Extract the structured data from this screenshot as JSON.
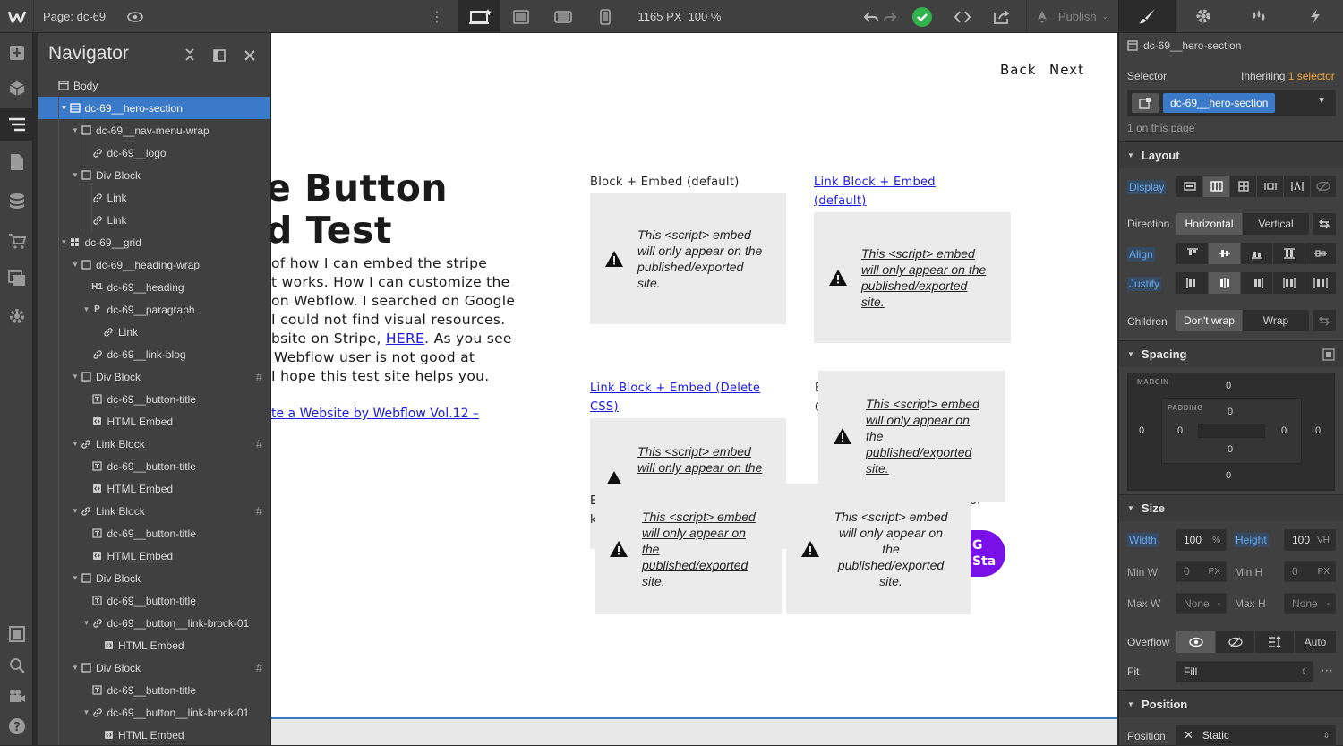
{
  "topbar": {
    "page_label": "Page: dc-69",
    "width_px": "1165 PX",
    "zoom": "100 %",
    "publish_label": "Publish"
  },
  "navigator": {
    "title": "Navigator",
    "rows": [
      {
        "label": "Body",
        "icon": "body-icon"
      },
      {
        "label": "dc-69__hero-section",
        "icon": "section-icon"
      },
      {
        "label": "dc-69__nav-menu-wrap",
        "icon": "div-icon"
      },
      {
        "label": "dc-69__logo",
        "icon": "link-icon"
      },
      {
        "label": "Div Block",
        "icon": "div-icon"
      },
      {
        "label": "Link",
        "icon": "link-icon"
      },
      {
        "label": "Link",
        "icon": "link-icon"
      },
      {
        "label": "dc-69__grid",
        "icon": "grid-icon"
      },
      {
        "label": "dc-69__heading-wrap",
        "icon": "div-icon"
      },
      {
        "label": "dc-69__heading",
        "icon": "heading-icon"
      },
      {
        "label": "dc-69__paragraph",
        "icon": "paragraph-icon"
      },
      {
        "label": "Link",
        "icon": "link-icon"
      },
      {
        "label": "dc-69__link-blog",
        "icon": "link-icon"
      },
      {
        "label": "Div Block",
        "icon": "div-icon"
      },
      {
        "label": "dc-69__button-title",
        "icon": "text-icon"
      },
      {
        "label": "HTML Embed",
        "icon": "embed-icon"
      },
      {
        "label": "Link Block",
        "icon": "link-icon"
      },
      {
        "label": "dc-69__button-title",
        "icon": "text-icon"
      },
      {
        "label": "HTML Embed",
        "icon": "embed-icon"
      },
      {
        "label": "Link Block",
        "icon": "link-icon"
      },
      {
        "label": "dc-69__button-title",
        "icon": "text-icon"
      },
      {
        "label": "HTML Embed",
        "icon": "embed-icon"
      },
      {
        "label": "Div Block",
        "icon": "div-icon"
      },
      {
        "label": "dc-69__button-title",
        "icon": "text-icon"
      },
      {
        "label": "dc-69__button__link-brock-01",
        "icon": "link-icon"
      },
      {
        "label": "HTML Embed",
        "icon": "embed-icon"
      },
      {
        "label": "Div Block",
        "icon": "div-icon"
      },
      {
        "label": "dc-69__button-title",
        "icon": "text-icon"
      },
      {
        "label": "dc-69__button__link-brock-01",
        "icon": "link-icon"
      },
      {
        "label": "HTML Embed",
        "icon": "embed-icon"
      }
    ],
    "hash_symbol": "#"
  },
  "canvas": {
    "nav_back": "Back",
    "nav_next": "Next",
    "hero_title_line1": "e Button",
    "hero_title_line2": "d Test",
    "para_lines": [
      "of how I can embed the stripe",
      "t works. How I can customize the",
      "on Webflow. I searched on Google",
      "I could not find visual resources.",
      "bsite on Stripe, "
    ],
    "para_link": "HERE",
    "para_after_link": ". As you see",
    "para_lines2": [
      "Webflow user is not good at",
      "I hope this test site helps you."
    ],
    "blog_link": "te a Website by Webflow Vol.12 –",
    "block1_label": "Block + Embed (default)",
    "block2_label_l1": "Link Block + Embed",
    "block2_label_l2": "(default)",
    "block3_label_l1": "Link Block + Embed (Delete",
    "block3_label_l2": "CSS)",
    "block4_label_fragment": "E",
    "block4_label_fragment2": "C",
    "block5_fragment": "E",
    "block5_fragment2": "k",
    "block6_fragment": "or",
    "embed_msg": "This <script> embed will only appear on the published/exported site.",
    "embed_msg_cut": "This <script> embed will only appear on the",
    "purple_line1": "G",
    "purple_line2": "Sta"
  },
  "style_panel": {
    "element_name": "dc-69__hero-section",
    "selector_label": "Selector",
    "inheriting_text": "Inheriting",
    "inheriting_count": "1 selector",
    "selector_chip": "dc-69__hero-section",
    "on_page": "1 on this page",
    "layout": {
      "title": "Layout",
      "display_label": "Display",
      "direction_label": "Direction",
      "direction_options": [
        "Horizontal",
        "Vertical"
      ],
      "align_label": "Align",
      "justify_label": "Justify",
      "children_label": "Children",
      "children_options": [
        "Don't wrap",
        "Wrap"
      ]
    },
    "spacing": {
      "title": "Spacing",
      "margin_label": "MARGIN",
      "padding_label": "PADDING",
      "margin": {
        "top": "0",
        "right": "0",
        "bottom": "0",
        "left": "0"
      },
      "padding": {
        "top": "0",
        "right": "0",
        "bottom": "0",
        "left": "0"
      }
    },
    "size": {
      "title": "Size",
      "width_label": "Width",
      "width_value": "100",
      "width_unit": "%",
      "height_label": "Height",
      "height_value": "100",
      "height_unit": "VH",
      "min_w_label": "Min W",
      "min_w_value": "0",
      "min_w_unit": "PX",
      "min_h_label": "Min H",
      "min_h_value": "0",
      "min_h_unit": "PX",
      "max_w_label": "Max W",
      "max_w_value": "None",
      "max_w_unit": "-",
      "max_h_label": "Max H",
      "max_h_value": "None",
      "max_h_unit": "-",
      "overflow_label": "Overflow",
      "overflow_auto": "Auto",
      "fit_label": "Fit",
      "fit_value": "Fill"
    },
    "position": {
      "title": "Position",
      "position_label": "Position",
      "position_value": "Static"
    }
  }
}
